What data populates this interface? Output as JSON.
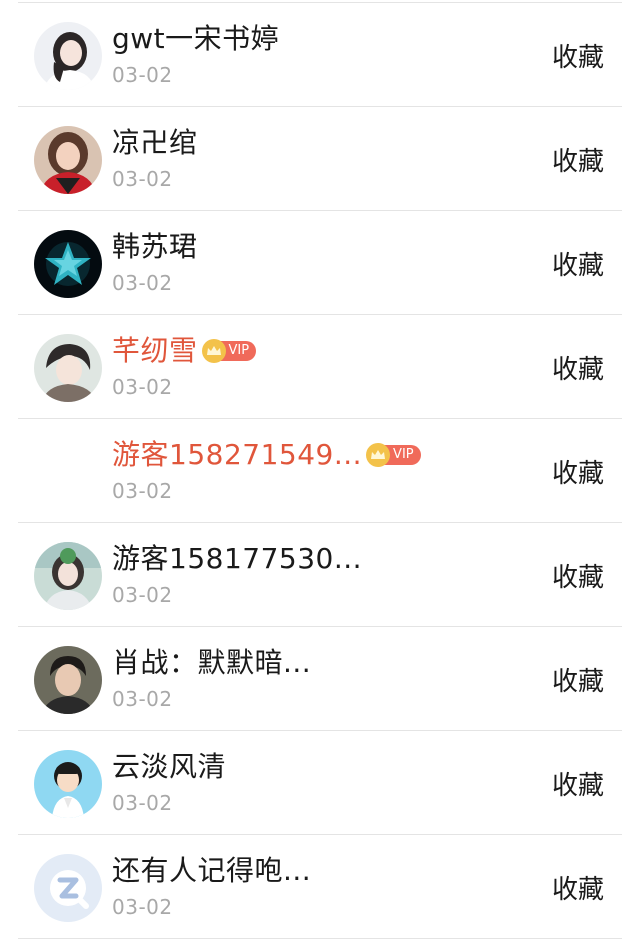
{
  "items": [
    {
      "name": "gwt一宋书婷",
      "date": "03-02",
      "action": "收藏",
      "vip": false,
      "avatar": "girl-portrait"
    },
    {
      "name": "凉卍绾",
      "date": "03-02",
      "action": "收藏",
      "vip": false,
      "avatar": "girl-red-jacket"
    },
    {
      "name": "韩苏珺",
      "date": "03-02",
      "action": "收藏",
      "vip": false,
      "avatar": "teal-star"
    },
    {
      "name": "芊纫雪",
      "date": "03-02",
      "action": "收藏",
      "vip": true,
      "vip_label": "VIP",
      "avatar": "anime-boy"
    },
    {
      "name": "游客158271549...",
      "date": "03-02",
      "action": "收藏",
      "vip": true,
      "vip_label": "VIP",
      "avatar": "none"
    },
    {
      "name": "游客158177530...",
      "date": "03-02",
      "action": "收藏",
      "vip": false,
      "avatar": "girl-outdoor"
    },
    {
      "name": "肖战：默默暗...",
      "date": "03-02",
      "action": "收藏",
      "vip": false,
      "avatar": "man-portrait"
    },
    {
      "name": "云淡风清",
      "date": "03-02",
      "action": "收藏",
      "vip": false,
      "avatar": "cartoon-boy"
    },
    {
      "name": "还有人记得咆...",
      "date": "03-02",
      "action": "收藏",
      "vip": false,
      "avatar": "default-logo"
    }
  ],
  "colors": {
    "vip_name": "#e0563b",
    "vip_badge": "#f06a5a",
    "vip_crown": "#f3c24a",
    "date": "#a8a8a8",
    "divider": "#e4e4e4"
  }
}
